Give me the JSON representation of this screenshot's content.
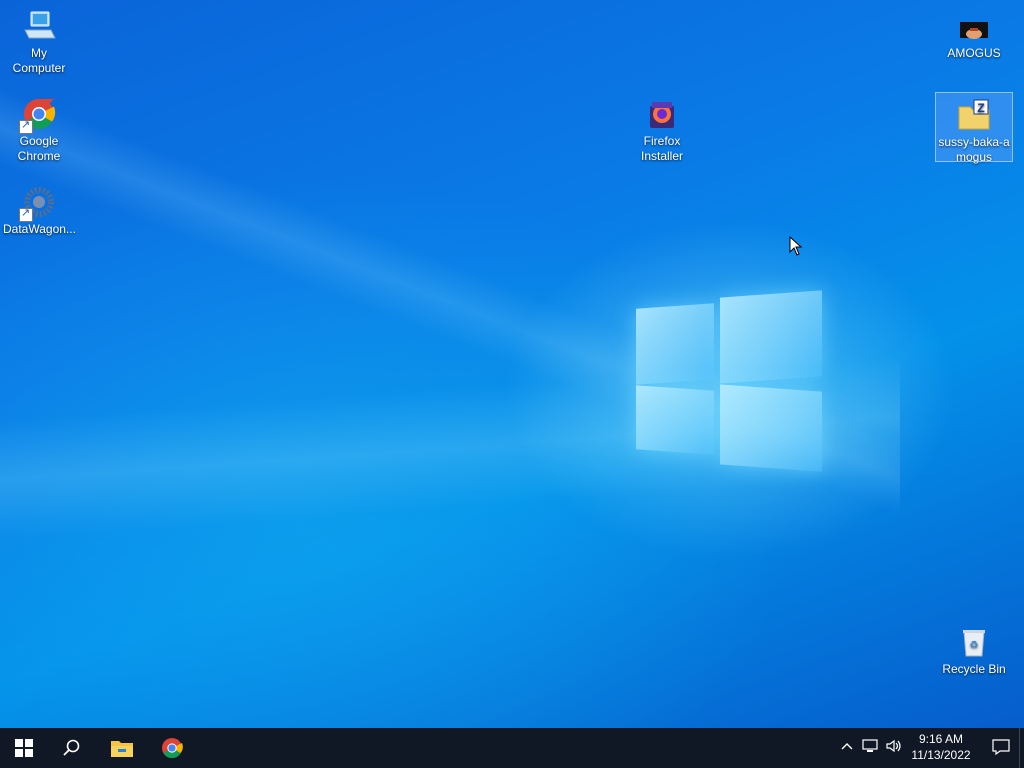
{
  "desktop": {
    "icons": [
      {
        "id": "my-computer",
        "label": "My Computer"
      },
      {
        "id": "google-chrome",
        "label": "Google\nChrome"
      },
      {
        "id": "datawagon",
        "label": "DataWagon..."
      },
      {
        "id": "firefox-installer",
        "label": "Firefox\nInstaller"
      },
      {
        "id": "amogus",
        "label": "AMOGUS"
      },
      {
        "id": "sussy-baka-amogus",
        "label": "sussy-baka-a\nmogus"
      },
      {
        "id": "recycle-bin",
        "label": "Recycle Bin"
      }
    ]
  },
  "taskbar": {
    "clock": {
      "time": "9:16 AM",
      "date": "11/13/2022"
    },
    "icons": [
      "windows-start-icon",
      "search-icon",
      "file-explorer-icon",
      "chrome-icon"
    ],
    "tray_icons": [
      "chevron-up-icon",
      "network-icon",
      "volume-icon",
      "notification-icon"
    ]
  },
  "colors": {
    "taskbar": "#101826",
    "accent": "#0a78e6"
  }
}
